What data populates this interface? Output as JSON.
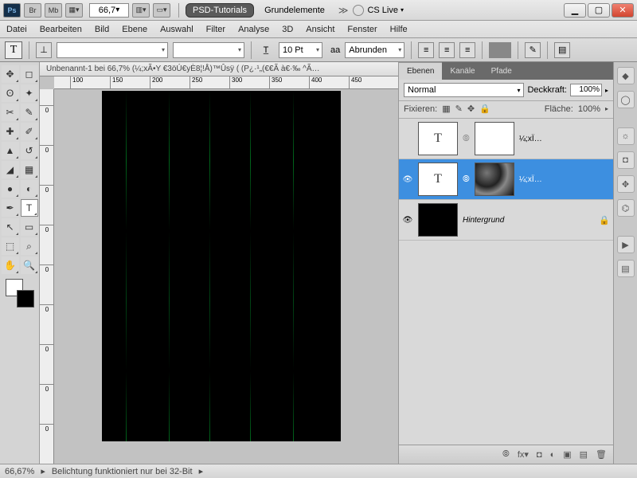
{
  "titlebar": {
    "app_short": "Ps",
    "br": "Br",
    "mb": "Mb",
    "zoom": "66,7",
    "workspace_active": "PSD-Tutorials",
    "workspace_other": "Grundelemente",
    "cslive": "CS Live"
  },
  "menu": {
    "datei": "Datei",
    "bearbeiten": "Bearbeiten",
    "bild": "Bild",
    "ebene": "Ebene",
    "auswahl": "Auswahl",
    "filter": "Filter",
    "analyse": "Analyse",
    "dreid": "3D",
    "ansicht": "Ansicht",
    "fenster": "Fenster",
    "hilfe": "Hilfe"
  },
  "options": {
    "tool_letter": "T",
    "font_size": "10 Pt",
    "aa_label": "aa",
    "aa_mode": "Abrunden"
  },
  "document": {
    "tab_title": "Unbenannt-1 bei 66,7% (¼;xÃ•Y €3öÚ€yÈ8¦!Å)™Ûsÿ     ( (P¿·¹„(€€Ã à€·‰ ^Ã…",
    "ruler_h": [
      "100",
      "150",
      "200",
      "250",
      "300",
      "350",
      "400",
      "450"
    ],
    "ruler_v": [
      "0",
      "0",
      "0",
      "0",
      "0",
      "0",
      "0",
      "0",
      "0",
      "0"
    ]
  },
  "layers_panel": {
    "tabs": {
      "ebenen": "Ebenen",
      "kanaele": "Kanäle",
      "pfade": "Pfade"
    },
    "blend_mode": "Normal",
    "opacity_label": "Deckkraft:",
    "opacity_value": "100%",
    "lock_label": "Fixieren:",
    "fill_label": "Fläche:",
    "fill_value": "100%",
    "layers": [
      {
        "name": "¼;xÏ…",
        "type": "text",
        "visible": false
      },
      {
        "name": "¼;xÏ…",
        "type": "text",
        "visible": true,
        "selected": true,
        "hasTexMask": true
      },
      {
        "name": "Hintergrund",
        "type": "bg",
        "visible": true,
        "locked": true
      }
    ],
    "footer_icons": [
      "link",
      "fx",
      "mask",
      "adjust",
      "group",
      "new",
      "trash"
    ]
  },
  "statusbar": {
    "zoom": "66,67%",
    "info": "Belichtung funktioniert nur bei 32-Bit"
  }
}
